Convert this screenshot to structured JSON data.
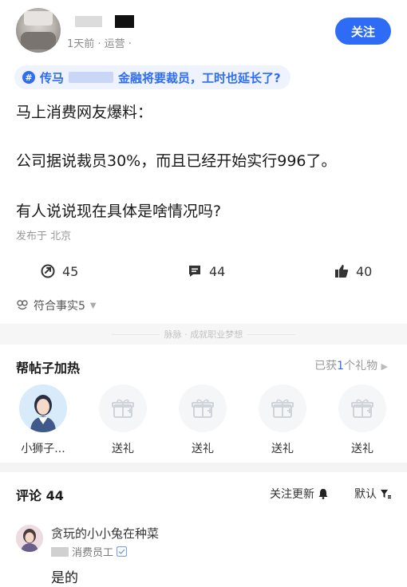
{
  "header": {
    "meta": "1天前 · 运营 ·",
    "follow_label": "关注"
  },
  "topic": {
    "prefix": "传马",
    "suffix": "金融将要裁员，工时也延长了?"
  },
  "post": {
    "line1": "马上消费网友爆料：",
    "line2": "公司据说裁员30%，而且已经开始实行996了。",
    "line3": "有人说说现在具体是啥情况吗?",
    "location": "发布于 北京"
  },
  "actions": {
    "share_count": "45",
    "comment_count": "44",
    "like_count": "40",
    "fact_label": "符合事实5"
  },
  "divider_text": "脉脉 · 成就职业梦想",
  "gift": {
    "title": "帮帖子加热",
    "count_pre": "已获",
    "count_num": "1",
    "count_post": "个礼物",
    "slots": [
      {
        "label": "小狮子..."
      },
      {
        "label": "送礼"
      },
      {
        "label": "送礼"
      },
      {
        "label": "送礼"
      },
      {
        "label": "送礼"
      }
    ]
  },
  "comments": {
    "title": "评论 44",
    "update_label": "关注更新",
    "sort_label": "默认",
    "items": [
      {
        "name": "贪玩的小小兔在种菜",
        "company": "消费员工",
        "text": "是的"
      }
    ]
  },
  "colors": {
    "accent": "#2f6cf6"
  }
}
